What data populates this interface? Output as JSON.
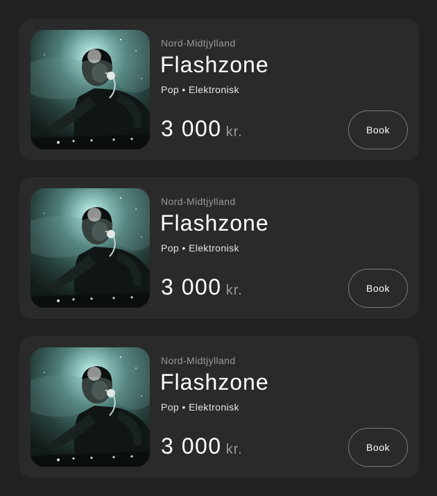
{
  "artists": [
    {
      "region": "Nord-Midtjylland",
      "name": "Flashzone",
      "genres": "Pop • Elektronisk",
      "price_amount": "3 000",
      "price_currency": "kr.",
      "book_label": "Book",
      "photo_icon": "dj-photo"
    },
    {
      "region": "Nord-Midtjylland",
      "name": "Flashzone",
      "genres": "Pop • Elektronisk",
      "price_amount": "3 000",
      "price_currency": "kr.",
      "book_label": "Book",
      "photo_icon": "dj-photo"
    },
    {
      "region": "Nord-Midtjylland",
      "name": "Flashzone",
      "genres": "Pop • Elektronisk",
      "price_amount": "3 000",
      "price_currency": "kr.",
      "book_label": "Book",
      "photo_icon": "dj-photo"
    }
  ],
  "colors": {
    "background": "#212121",
    "card": "#2a2a2a",
    "muted_text": "#9a9a9a",
    "button_border": "#7a7a7a"
  }
}
